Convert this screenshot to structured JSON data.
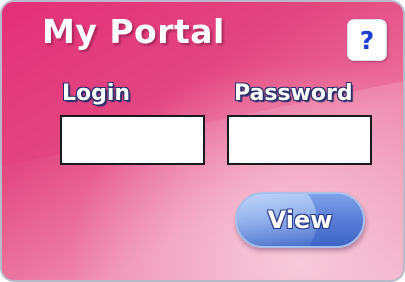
{
  "portal": {
    "title": "My Portal",
    "help_icon": "question-mark-icon",
    "help_glyph": "?",
    "login_label": "Login",
    "login_value": "",
    "password_label": "Password",
    "password_value": "",
    "view_label": "View"
  },
  "colors": {
    "panel_pink": "#e42f79",
    "panel_light_pink": "#f1a5c2",
    "button_blue": "#5b80d9",
    "help_blue": "#1d3fd0",
    "label_outline": "#2b2f6b"
  }
}
